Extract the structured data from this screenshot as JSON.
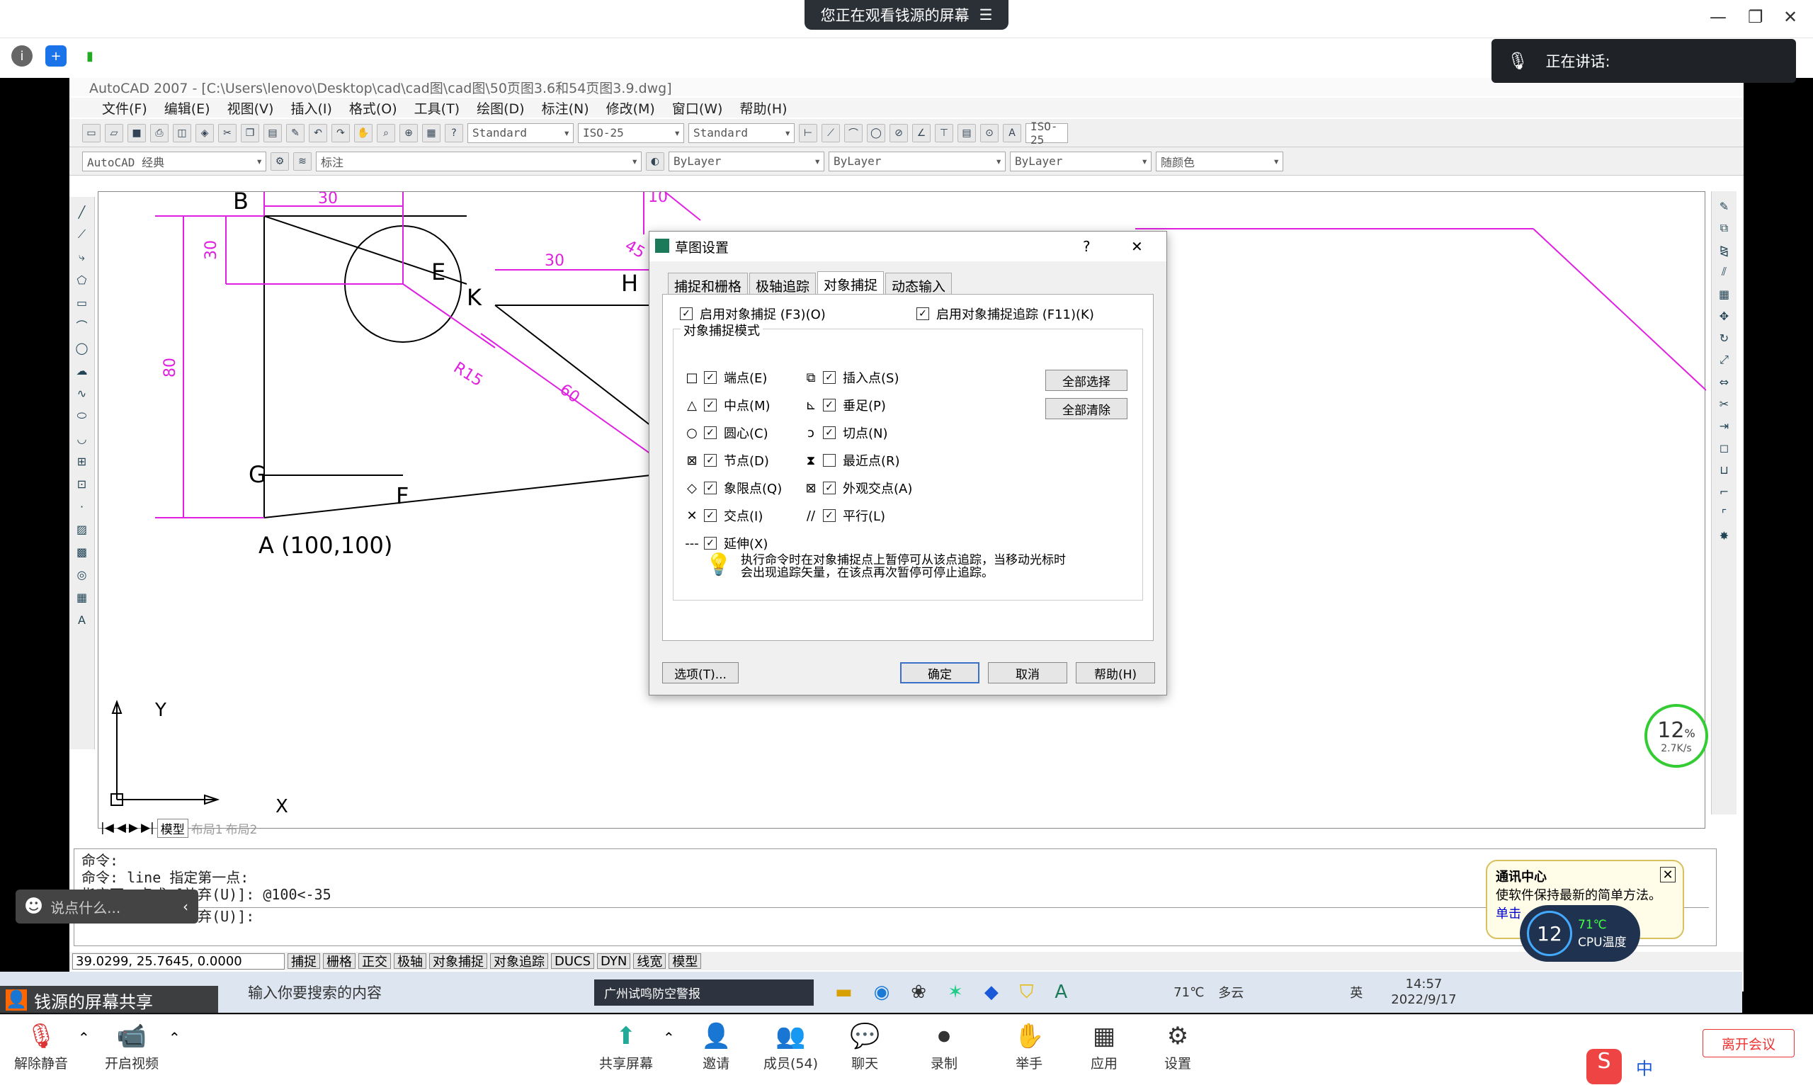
{
  "meeting": {
    "banner": "您正在观看钱源的屏幕",
    "banner_menu_icon": "☰",
    "speaking_label": "正在讲话:",
    "chat_placeholder": "说点什么...",
    "sharer_label": "钱源的屏幕共享"
  },
  "cad": {
    "title": "AutoCAD 2007 - [C:\\Users\\lenovo\\Desktop\\cad\\cad图\\cad图\\50页图3.6和54页图3.9.dwg]",
    "menu": [
      "文件(F)",
      "编辑(E)",
      "视图(V)",
      "插入(I)",
      "格式(O)",
      "工具(T)",
      "绘图(D)",
      "标注(N)",
      "修改(M)",
      "窗口(W)",
      "帮助(H)"
    ],
    "text_style": "Standard",
    "dim_style": "ISO-25",
    "table_style": "Standard",
    "dim_style_right": "ISO-25",
    "workspace": "AutoCAD 经典",
    "layer": "标注",
    "color": "ByLayer",
    "linetype": "ByLayer",
    "lineweight": "ByLayer",
    "plotstyle": "随颜色",
    "drawing_labels": {
      "B": "B",
      "E": "E",
      "G": "G",
      "F": "F",
      "A": "A (100,100)",
      "K": "K",
      "H": "H",
      "dim30a": "30",
      "dim30v": "30",
      "dim80": "80",
      "dimR15": "R15",
      "dim30b": "30",
      "dim60": "60",
      "dim10": "10",
      "dim45": "45",
      "X": "X",
      "Y": "Y"
    },
    "layout_tabs": [
      "模型",
      "布局1",
      "布局2"
    ],
    "command_lines": [
      "命令:",
      "命令:  line 指定第一点:",
      "指定下一点或 [放弃(U)]: @100<-35",
      "指定下一点或 [放弃(U)]:"
    ],
    "coords": "39.0299,  25.7645, 0.0000",
    "status_buttons": [
      "捕捉",
      "栅格",
      "正交",
      "极轴",
      "对象捕捉",
      "对象追踪",
      "DUCS",
      "DYN",
      "线宽",
      "模型"
    ]
  },
  "dialog": {
    "title": "草图设置",
    "help": "?",
    "close": "✕",
    "tabs": [
      "捕捉和栅格",
      "极轴追踪",
      "对象捕捉",
      "动态输入"
    ],
    "enable_osnap": "启用对象捕捉 (F3)(O)",
    "enable_tracking": "启用对象捕捉追踪 (F11)(K)",
    "group_label": "对象捕捉模式",
    "left_modes": [
      {
        "label": "端点(E)",
        "checked": true
      },
      {
        "label": "中点(M)",
        "checked": true
      },
      {
        "label": "圆心(C)",
        "checked": true
      },
      {
        "label": "节点(D)",
        "checked": true
      },
      {
        "label": "象限点(Q)",
        "checked": true
      },
      {
        "label": "交点(I)",
        "checked": true
      },
      {
        "label": "延伸(X)",
        "checked": true
      }
    ],
    "right_modes": [
      {
        "label": "插入点(S)",
        "checked": true
      },
      {
        "label": "垂足(P)",
        "checked": true
      },
      {
        "label": "切点(N)",
        "checked": true
      },
      {
        "label": "最近点(R)",
        "checked": false
      },
      {
        "label": "外观交点(A)",
        "checked": true
      },
      {
        "label": "平行(L)",
        "checked": true
      }
    ],
    "select_all": "全部选择",
    "clear_all": "全部清除",
    "hint_line1": "执行命令时在对象捕捉点上暂停可从该点追踪，当移动光标时",
    "hint_line2": "会出现追踪矢量，在该点再次暂停可停止追踪。",
    "options_btn": "选项(T)...",
    "ok_btn": "确定",
    "cancel_btn": "取消",
    "help_btn": "帮助(H)"
  },
  "notification": {
    "title": "通讯中心",
    "text": "使软件保持最新的简单方法。",
    "link": "单击",
    "cpu_percent": "12",
    "cpu_temp": "71℃",
    "cpu_label": "CPU温度"
  },
  "net_widget": {
    "percent": "12",
    "unit": "%",
    "speed": "2.7K/s"
  },
  "taskbar": {
    "search_placeholder": "输入你要搜索的内容",
    "browser_tab": "广州试鸣防空警报",
    "weather": "71℃",
    "weather2": "多云",
    "weather3": "CPU温度",
    "ime": "英",
    "time": "14:57",
    "date": "2022/9/17"
  },
  "bottom": {
    "unmute": "解除静音",
    "video": "开启视频",
    "share": "共享屏幕",
    "invite": "邀请",
    "members": "成员(54)",
    "chat": "聊天",
    "record": "录制",
    "raise": "举手",
    "apps": "应用",
    "settings": "设置",
    "leave": "离开会议",
    "ime_cn": "中"
  }
}
